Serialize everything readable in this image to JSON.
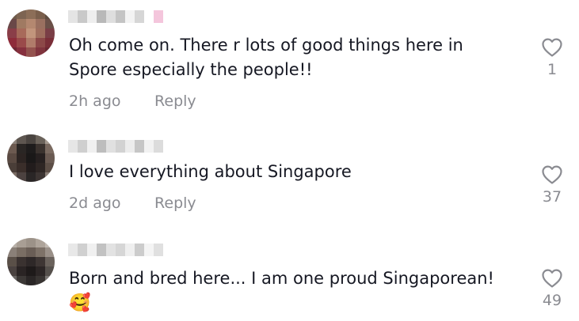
{
  "comments": [
    {
      "text_line1": "Oh come on. There r lots of good things here in",
      "text_line2": "Spore especially the people!!",
      "time": "2h ago",
      "reply_label": "Reply",
      "like_count": "1",
      "avatar_colors": [
        "#6e5a4a",
        "#7d6452",
        "#8c6e58",
        "#7a5f4c",
        "#5e4c40",
        "#6a4848",
        "#a07a62",
        "#b48870",
        "#9a7060",
        "#6b5048",
        "#8a3e48",
        "#a86a5a",
        "#c2957c",
        "#a06e5e",
        "#7a3e46",
        "#8e2c3a",
        "#9a4a4a",
        "#b07c6a",
        "#8c4848",
        "#7a2e38",
        "#6e2834",
        "#86303e",
        "#94524e",
        "#80343e",
        "#6a2832"
      ],
      "username_colors": [
        "#e4e4e4",
        "#c9c9c9",
        "#eeeeee",
        "#b9b9b9",
        "#dedede",
        "#c4c4c4",
        "#f3f3f3",
        "#d6d6d6",
        "#ffffff",
        "#f4c6dc"
      ]
    },
    {
      "text_line1": "I love everything about Singapore",
      "time": "2d ago",
      "reply_label": "Reply",
      "like_count": "37",
      "avatar_colors": [
        "#8a8078",
        "#5e5650",
        "#4a4440",
        "#6a625a",
        "#a49a90",
        "#6c5a50",
        "#2a2624",
        "#1e1c1c",
        "#3a322e",
        "#7a6a60",
        "#5a4a42",
        "#2c2422",
        "#1a1818",
        "#262020",
        "#6a5a52",
        "#4a3e38",
        "#3a2e2a",
        "#221c1c",
        "#2e2624",
        "#5c4e46",
        "#7a6c64",
        "#4c4240",
        "#2a2626",
        "#3c3432",
        "#8a7e76"
      ],
      "username_colors": [
        "#e6e6e6",
        "#cfcfcf",
        "#f0f0f0",
        "#bdbdbd",
        "#e0e0e0",
        "#d2d2d2",
        "#ececec",
        "#c6c6c6",
        "#f2f2f2",
        "#dcdcdc"
      ]
    },
    {
      "text_line1": "Born and bred here... I am one proud Singaporean!",
      "emoji": "🥰",
      "like_count": "49",
      "avatar_colors": [
        "#b8b0a8",
        "#a89e94",
        "#9c9288",
        "#aea49a",
        "#c2bab2",
        "#8a8078",
        "#7a6e64",
        "#6a5e56",
        "#7e7268",
        "#9a9088",
        "#5a5048",
        "#3a3230",
        "#2e2828",
        "#3e3634",
        "#6a625c",
        "#4a4240",
        "#2a2424",
        "#1e1a1a",
        "#2c2626",
        "#55504c",
        "#6a6664",
        "#3c3836",
        "#2a2626",
        "#383432",
        "#7a7674"
      ],
      "username_colors": [
        "#e8e8e8",
        "#d0d0d0",
        "#f0f0f0",
        "#c2c2c2",
        "#e2e2e2",
        "#d6d6d6",
        "#efefef",
        "#cccccc",
        "#f4f4f4",
        "#e0e0e0"
      ]
    }
  ]
}
